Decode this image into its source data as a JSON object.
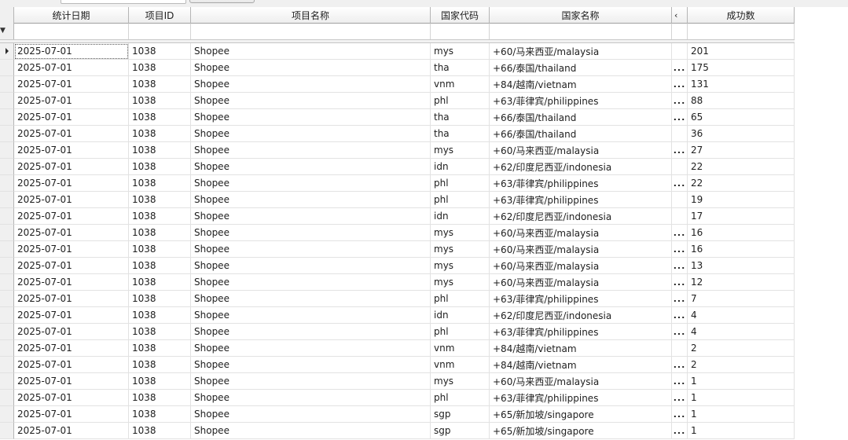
{
  "grid": {
    "columns": [
      {
        "key": "date",
        "label": "统计日期"
      },
      {
        "key": "project_id",
        "label": "项目ID"
      },
      {
        "key": "project_name",
        "label": "项目名称"
      },
      {
        "key": "country_code",
        "label": "国家代码"
      },
      {
        "key": "country_name",
        "label": "国家名称"
      },
      {
        "key": "truncated",
        "label": "‹"
      },
      {
        "key": "success_count",
        "label": "成功数"
      }
    ],
    "filter_icon": "filter-icon",
    "rows": [
      {
        "date": "2025-07-01",
        "project_id": "1038",
        "project_name": "Shopee",
        "country_code": "mys",
        "country_name": "+60/马来西亚/malaysia",
        "t": "",
        "success_count": "201"
      },
      {
        "date": "2025-07-01",
        "project_id": "1038",
        "project_name": "Shopee",
        "country_code": "tha",
        "country_name": "+66/泰国/thailand",
        "t": "...",
        "success_count": "175"
      },
      {
        "date": "2025-07-01",
        "project_id": "1038",
        "project_name": "Shopee",
        "country_code": "vnm",
        "country_name": "+84/越南/vietnam",
        "t": "...",
        "success_count": "131"
      },
      {
        "date": "2025-07-01",
        "project_id": "1038",
        "project_name": "Shopee",
        "country_code": "phl",
        "country_name": "+63/菲律宾/philippines",
        "t": "...",
        "success_count": "88"
      },
      {
        "date": "2025-07-01",
        "project_id": "1038",
        "project_name": "Shopee",
        "country_code": "tha",
        "country_name": "+66/泰国/thailand",
        "t": "...",
        "success_count": "65"
      },
      {
        "date": "2025-07-01",
        "project_id": "1038",
        "project_name": "Shopee",
        "country_code": "tha",
        "country_name": "+66/泰国/thailand",
        "t": "",
        "success_count": "36"
      },
      {
        "date": "2025-07-01",
        "project_id": "1038",
        "project_name": "Shopee",
        "country_code": "mys",
        "country_name": "+60/马来西亚/malaysia",
        "t": "...",
        "success_count": "27"
      },
      {
        "date": "2025-07-01",
        "project_id": "1038",
        "project_name": "Shopee",
        "country_code": "idn",
        "country_name": "+62/印度尼西亚/indonesia",
        "t": "",
        "success_count": "22"
      },
      {
        "date": "2025-07-01",
        "project_id": "1038",
        "project_name": "Shopee",
        "country_code": "phl",
        "country_name": "+63/菲律宾/philippines",
        "t": "...",
        "success_count": "22"
      },
      {
        "date": "2025-07-01",
        "project_id": "1038",
        "project_name": "Shopee",
        "country_code": "phl",
        "country_name": "+63/菲律宾/philippines",
        "t": "",
        "success_count": "19"
      },
      {
        "date": "2025-07-01",
        "project_id": "1038",
        "project_name": "Shopee",
        "country_code": "idn",
        "country_name": "+62/印度尼西亚/indonesia",
        "t": "",
        "success_count": "17"
      },
      {
        "date": "2025-07-01",
        "project_id": "1038",
        "project_name": "Shopee",
        "country_code": "mys",
        "country_name": "+60/马来西亚/malaysia",
        "t": "...",
        "success_count": "16"
      },
      {
        "date": "2025-07-01",
        "project_id": "1038",
        "project_name": "Shopee",
        "country_code": "mys",
        "country_name": "+60/马来西亚/malaysia",
        "t": "...",
        "success_count": "16"
      },
      {
        "date": "2025-07-01",
        "project_id": "1038",
        "project_name": "Shopee",
        "country_code": "mys",
        "country_name": "+60/马来西亚/malaysia",
        "t": "...",
        "success_count": "13"
      },
      {
        "date": "2025-07-01",
        "project_id": "1038",
        "project_name": "Shopee",
        "country_code": "mys",
        "country_name": "+60/马来西亚/malaysia",
        "t": "...",
        "success_count": "12"
      },
      {
        "date": "2025-07-01",
        "project_id": "1038",
        "project_name": "Shopee",
        "country_code": "phl",
        "country_name": "+63/菲律宾/philippines",
        "t": "...",
        "success_count": "7"
      },
      {
        "date": "2025-07-01",
        "project_id": "1038",
        "project_name": "Shopee",
        "country_code": "idn",
        "country_name": "+62/印度尼西亚/indonesia",
        "t": "...",
        "success_count": "4"
      },
      {
        "date": "2025-07-01",
        "project_id": "1038",
        "project_name": "Shopee",
        "country_code": "phl",
        "country_name": "+63/菲律宾/philippines",
        "t": "...",
        "success_count": "4"
      },
      {
        "date": "2025-07-01",
        "project_id": "1038",
        "project_name": "Shopee",
        "country_code": "vnm",
        "country_name": "+84/越南/vietnam",
        "t": "",
        "success_count": "2"
      },
      {
        "date": "2025-07-01",
        "project_id": "1038",
        "project_name": "Shopee",
        "country_code": "vnm",
        "country_name": "+84/越南/vietnam",
        "t": "...",
        "success_count": "2"
      },
      {
        "date": "2025-07-01",
        "project_id": "1038",
        "project_name": "Shopee",
        "country_code": "mys",
        "country_name": "+60/马来西亚/malaysia",
        "t": "...",
        "success_count": "1"
      },
      {
        "date": "2025-07-01",
        "project_id": "1038",
        "project_name": "Shopee",
        "country_code": "phl",
        "country_name": "+63/菲律宾/philippines",
        "t": "...",
        "success_count": "1"
      },
      {
        "date": "2025-07-01",
        "project_id": "1038",
        "project_name": "Shopee",
        "country_code": "sgp",
        "country_name": "+65/新加坡/singapore",
        "t": "...",
        "success_count": "1"
      },
      {
        "date": "2025-07-01",
        "project_id": "1038",
        "project_name": "Shopee",
        "country_code": "sgp",
        "country_name": "+65/新加坡/singapore",
        "t": "...",
        "success_count": "1"
      }
    ]
  }
}
